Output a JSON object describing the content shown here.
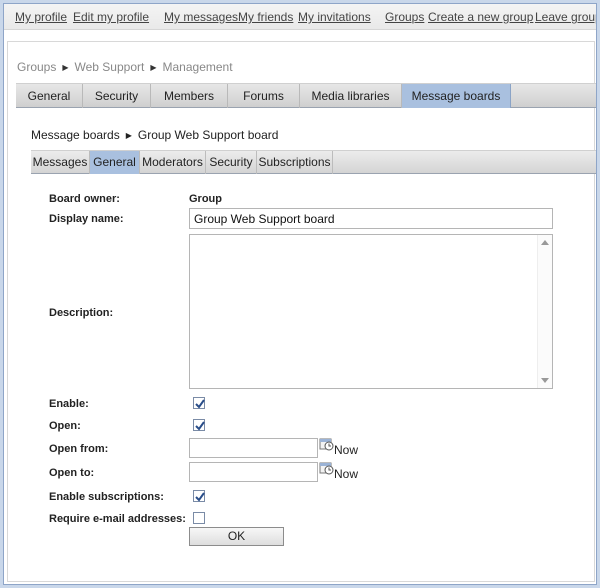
{
  "topnav": {
    "links": [
      "My profile",
      "Edit my profile",
      "My messages",
      "My friends",
      "My invitations",
      "Groups",
      "Create a new group",
      "Leave group"
    ]
  },
  "breadcrumb": [
    "Groups",
    "Web Support",
    "Management"
  ],
  "main_tabs": [
    "General",
    "Security",
    "Members",
    "Forums",
    "Media libraries",
    "Message boards"
  ],
  "main_tabs_active": "Message boards",
  "sub_breadcrumb": [
    "Message boards",
    "Group Web Support board"
  ],
  "board_tabs": [
    "Messages",
    "General",
    "Moderators",
    "Security",
    "Subscriptions"
  ],
  "board_tabs_active": "General",
  "form": {
    "board_owner_label": "Board owner:",
    "board_owner_value": "Group",
    "display_name_label": "Display name:",
    "display_name_value": "Group Web Support board",
    "description_label": "Description:",
    "description_value": "",
    "enable_label": "Enable:",
    "enable_checked": true,
    "open_label": "Open:",
    "open_checked": true,
    "open_from_label": "Open from:",
    "open_from_value": "",
    "open_to_label": "Open to:",
    "open_to_value": "",
    "now_label": "Now",
    "enable_subscriptions_label": "Enable subscriptions:",
    "enable_subscriptions_checked": true,
    "require_email_label": "Require e-mail addresses:",
    "require_email_checked": false,
    "ok_label": "OK"
  },
  "colors": {
    "active_tab": "#a9c0df",
    "page_border": "#c9d7ea"
  },
  "icons": [
    "chevron-right-icon",
    "calendar-icon",
    "checkmark-icon"
  ]
}
